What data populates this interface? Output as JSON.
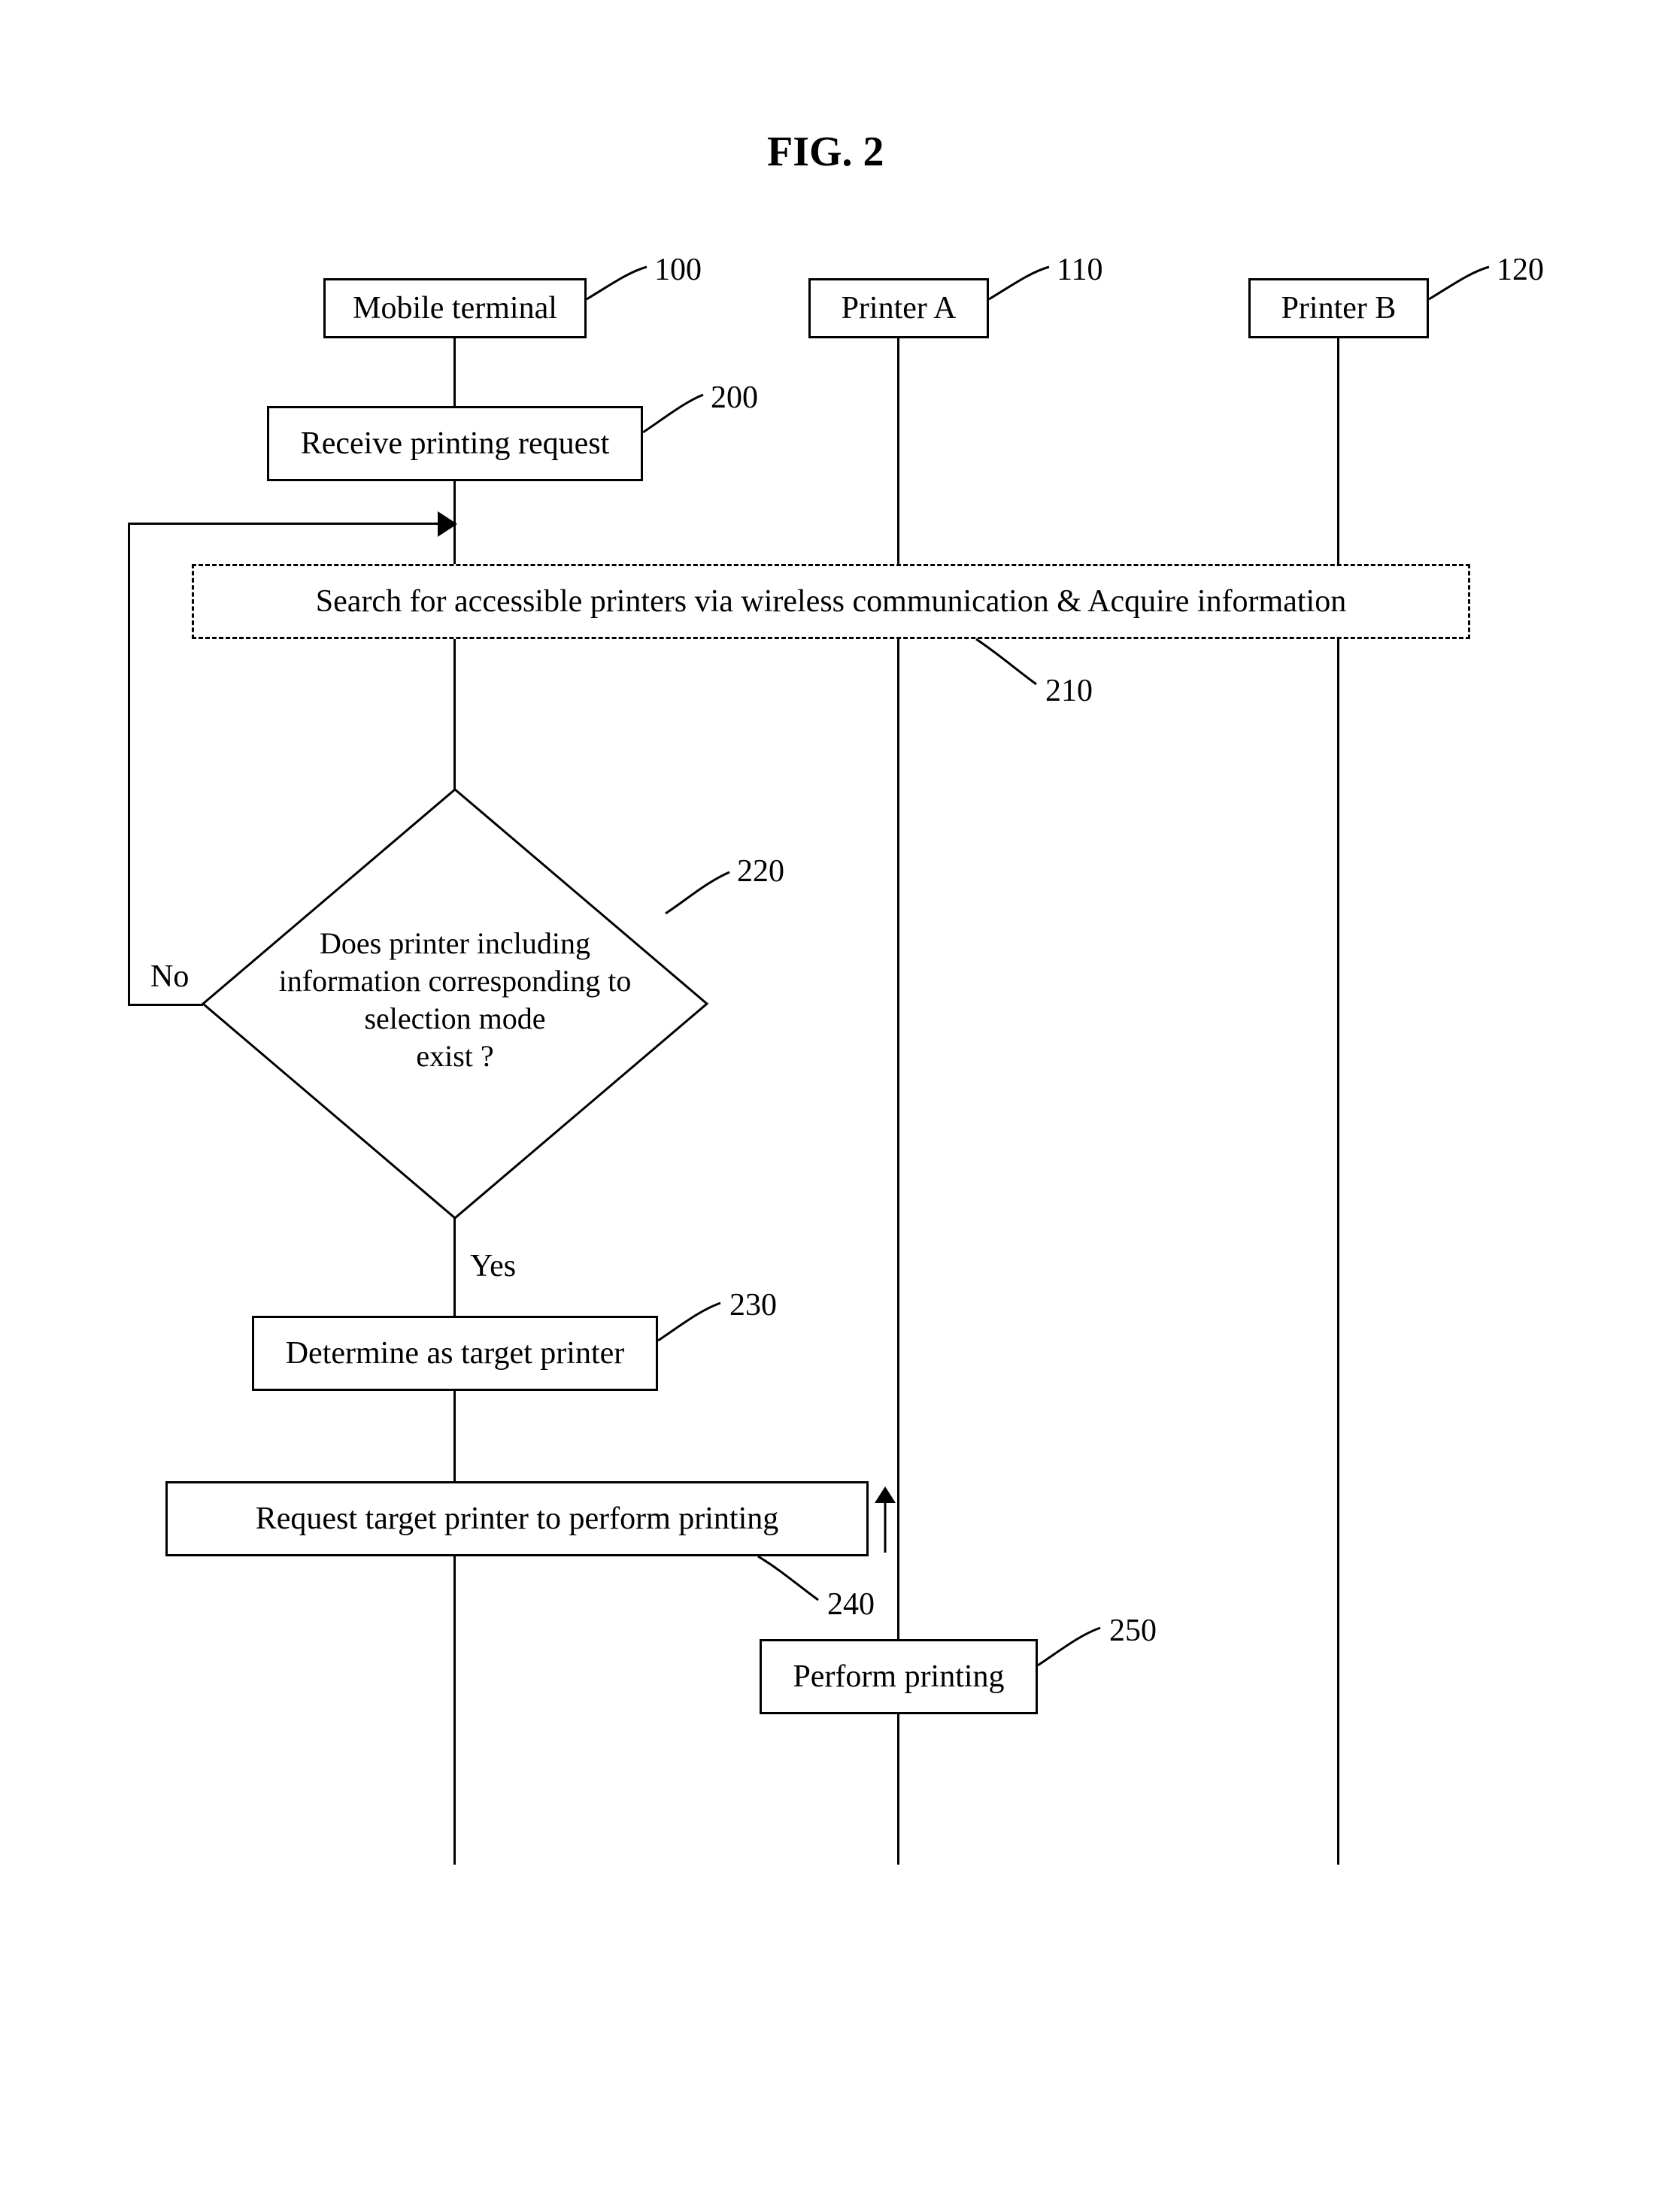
{
  "figure_title": "FIG. 2",
  "swimlanes": {
    "mobile_terminal": {
      "label": "Mobile terminal",
      "ref": "100"
    },
    "printer_a": {
      "label": "Printer A",
      "ref": "110"
    },
    "printer_b": {
      "label": "Printer B",
      "ref": "120"
    }
  },
  "steps": {
    "s200": {
      "label": "Receive printing request",
      "ref": "200"
    },
    "s210": {
      "label": "Search for accessible printers via wireless communication & Acquire information",
      "ref": "210"
    },
    "s220": {
      "label": "Does printer including\ninformation corresponding to\nselection mode\nexist ?",
      "ref": "220",
      "yes_label": "Yes",
      "no_label": "No"
    },
    "s230": {
      "label": "Determine as target printer",
      "ref": "230"
    },
    "s240": {
      "label": "Request target printer to perform printing",
      "ref": "240"
    },
    "s250": {
      "label": "Perform printing",
      "ref": "250"
    }
  },
  "chart_data": {
    "type": "flowchart-swimlane",
    "lanes": [
      "Mobile terminal",
      "Printer A",
      "Printer B"
    ],
    "nodes": [
      {
        "id": "100",
        "lane": "Mobile terminal",
        "kind": "terminator",
        "label": "Mobile terminal"
      },
      {
        "id": "110",
        "lane": "Printer A",
        "kind": "terminator",
        "label": "Printer A"
      },
      {
        "id": "120",
        "lane": "Printer B",
        "kind": "terminator",
        "label": "Printer B"
      },
      {
        "id": "200",
        "lane": "Mobile terminal",
        "kind": "process",
        "label": "Receive printing request"
      },
      {
        "id": "210",
        "lane": "all",
        "kind": "process-dashed",
        "label": "Search for accessible printers via wireless communication & Acquire information"
      },
      {
        "id": "220",
        "lane": "Mobile terminal",
        "kind": "decision",
        "label": "Does printer including information corresponding to selection mode exist ?"
      },
      {
        "id": "230",
        "lane": "Mobile terminal",
        "kind": "process",
        "label": "Determine as target printer"
      },
      {
        "id": "240",
        "lane": "Mobile terminal→Printer A",
        "kind": "process",
        "label": "Request target printer to perform printing"
      },
      {
        "id": "250",
        "lane": "Printer A",
        "kind": "process",
        "label": "Perform printing"
      }
    ],
    "edges": [
      {
        "from": "100",
        "to": "200"
      },
      {
        "from": "200",
        "to": "210"
      },
      {
        "from": "210",
        "to": "220"
      },
      {
        "from": "220",
        "to": "230",
        "label": "Yes"
      },
      {
        "from": "220",
        "to": "210",
        "label": "No",
        "kind": "loop-back"
      },
      {
        "from": "230",
        "to": "240"
      },
      {
        "from": "240",
        "to": "250",
        "arrow": true
      },
      {
        "from": "110",
        "to": "end",
        "kind": "lifeline"
      },
      {
        "from": "120",
        "to": "end",
        "kind": "lifeline"
      },
      {
        "from": "100",
        "to": "end",
        "kind": "lifeline"
      }
    ]
  }
}
